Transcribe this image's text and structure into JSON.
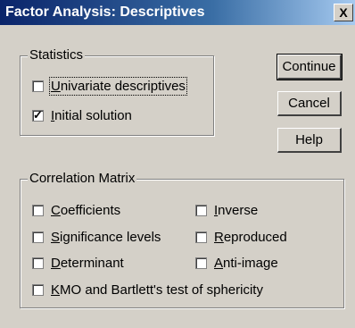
{
  "window": {
    "title": "Factor Analysis: Descriptives",
    "close_label": "X"
  },
  "statistics": {
    "label": "Statistics",
    "items": [
      {
        "label": "Univariate descriptives",
        "checked": false
      },
      {
        "label": "Initial solution",
        "checked": true
      }
    ]
  },
  "buttons": {
    "continue": "Continue",
    "cancel": "Cancel",
    "help": "Help"
  },
  "correlation_matrix": {
    "label": "Correlation Matrix",
    "items": [
      {
        "label": "Coefficients",
        "checked": false
      },
      {
        "label": "Inverse",
        "checked": false
      },
      {
        "label": "Significance levels",
        "checked": false
      },
      {
        "label": "Reproduced",
        "checked": false
      },
      {
        "label": "Determinant",
        "checked": false
      },
      {
        "label": "Anti-image",
        "checked": false
      },
      {
        "label": "KMO and Bartlett's test of sphericity",
        "checked": false
      }
    ]
  }
}
